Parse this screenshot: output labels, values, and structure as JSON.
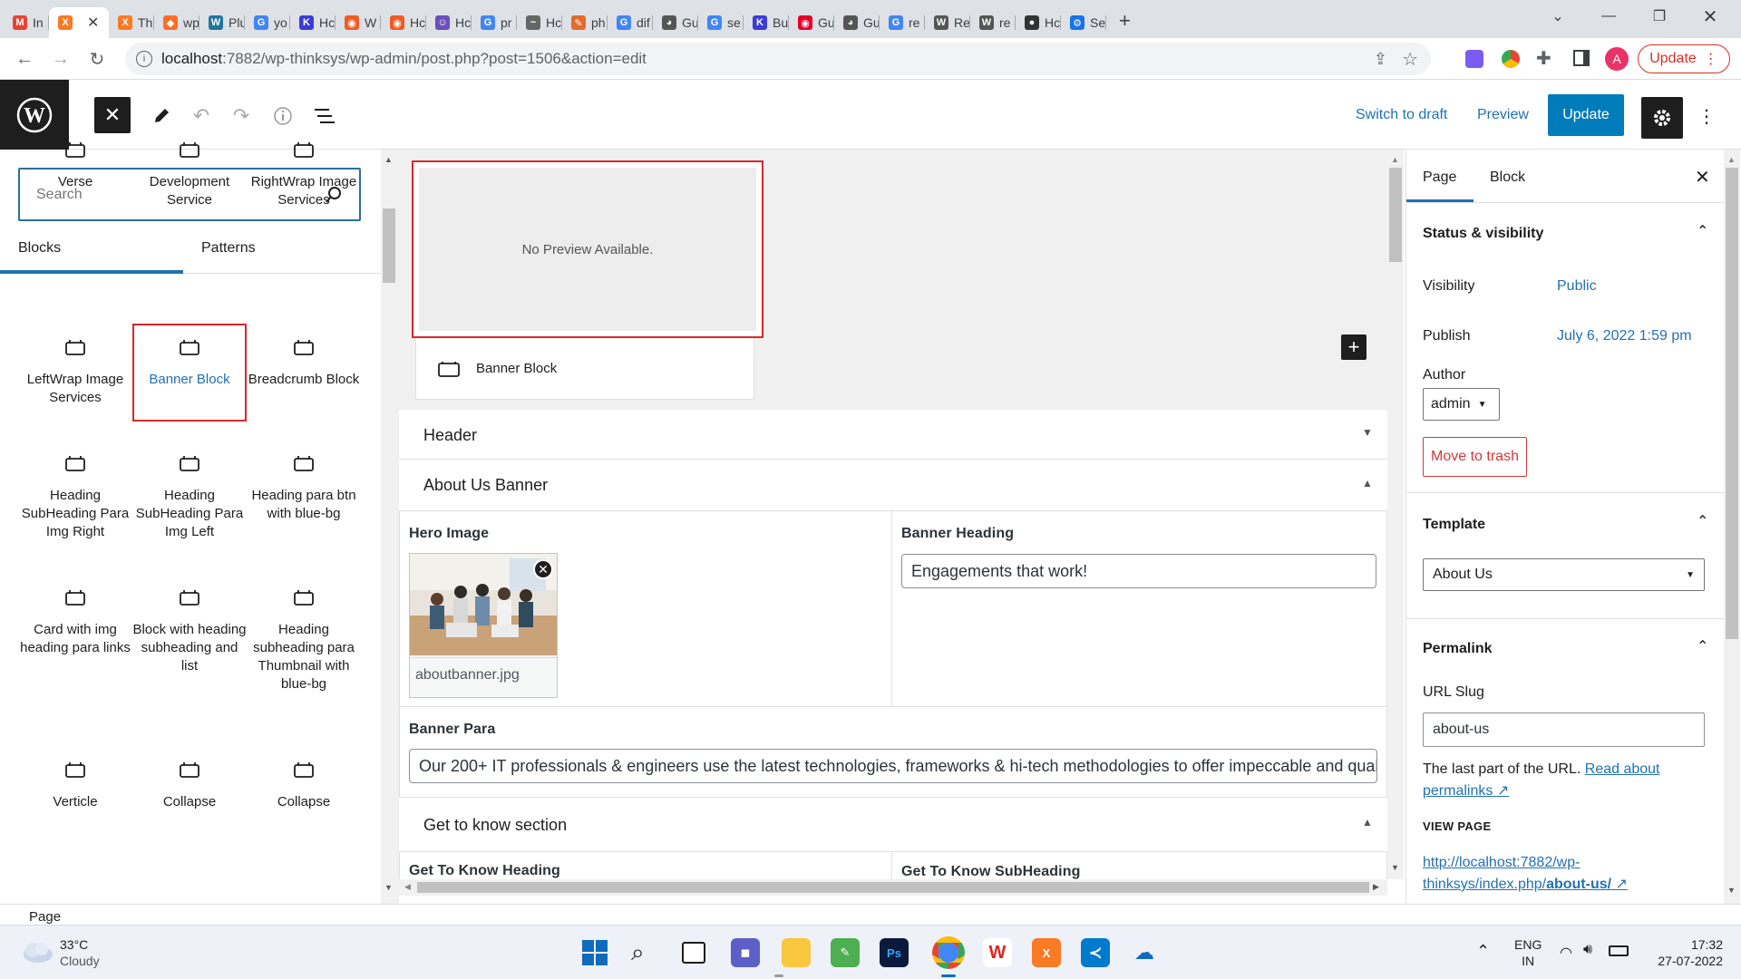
{
  "browser": {
    "tabs": [
      {
        "label": "In",
        "favicon": "gmail-icon",
        "color": "#ea4335",
        "glyph": "M"
      },
      {
        "label": "",
        "favicon": "xampp-icon",
        "color": "#fb7a24",
        "glyph": "X",
        "active": true
      },
      {
        "label": "Th",
        "favicon": "xampp-icon",
        "color": "#fb7a24",
        "glyph": "X"
      },
      {
        "label": "wp",
        "favicon": "gitlab-icon",
        "color": "#fc6d26",
        "glyph": "◆"
      },
      {
        "label": "Plu",
        "favicon": "wordpress-icon",
        "color": "#21759b",
        "glyph": "W"
      },
      {
        "label": "yo",
        "favicon": "google-icon",
        "color": "#4285f4",
        "glyph": "G"
      },
      {
        "label": "Hc",
        "favicon": "k-icon",
        "color": "#3b3bd6",
        "glyph": "K"
      },
      {
        "label": "W",
        "favicon": "ws-icon",
        "color": "#f15a24",
        "glyph": "◉"
      },
      {
        "label": "Hc",
        "favicon": "ws-icon",
        "color": "#f15a24",
        "glyph": "◉"
      },
      {
        "label": "Hc",
        "favicon": "bot-icon",
        "color": "#6b4fbb",
        "glyph": "☺"
      },
      {
        "label": "pr",
        "favicon": "google-icon",
        "color": "#4285f4",
        "glyph": "G"
      },
      {
        "label": "Hc",
        "favicon": "scribble-icon",
        "color": "#666666",
        "glyph": "~"
      },
      {
        "label": "ph",
        "favicon": "php-icon",
        "color": "#e36b2c",
        "glyph": "✎"
      },
      {
        "label": "dif",
        "favicon": "google-icon",
        "color": "#4285f4",
        "glyph": "G"
      },
      {
        "label": "Gu",
        "favicon": "globe-icon",
        "color": "#555555",
        "glyph": "◕"
      },
      {
        "label": "se",
        "favicon": "google-icon",
        "color": "#4285f4",
        "glyph": "G"
      },
      {
        "label": "Bu",
        "favicon": "k-icon",
        "color": "#3b3bd6",
        "glyph": "K"
      },
      {
        "label": "Gu",
        "favicon": "fire-icon",
        "color": "#e4002b",
        "glyph": "◉"
      },
      {
        "label": "Gu",
        "favicon": "globe-icon",
        "color": "#555555",
        "glyph": "◕"
      },
      {
        "label": "re",
        "favicon": "google-icon",
        "color": "#4285f4",
        "glyph": "G"
      },
      {
        "label": "Re",
        "favicon": "wordpress-icon",
        "color": "#555555",
        "glyph": "W"
      },
      {
        "label": "re",
        "favicon": "wordpress-icon",
        "color": "#555555",
        "glyph": "W"
      },
      {
        "label": "Hc",
        "favicon": "person-icon",
        "color": "#333333",
        "glyph": "●"
      },
      {
        "label": "Se",
        "favicon": "gear-icon",
        "color": "#1a73e8",
        "glyph": "⚙"
      }
    ],
    "url_host": "localhost",
    "url_rest": ":7882/wp-thinksys/wp-admin/post.php?post=1506&action=edit",
    "profile_initial": "A",
    "update_label": "Update"
  },
  "wp_header": {
    "switch_to_draft": "Switch to draft",
    "preview": "Preview",
    "update": "Update"
  },
  "inserter": {
    "search_placeholder": "Search",
    "tabs": [
      "Blocks",
      "Patterns"
    ],
    "rows": [
      [
        "Verse",
        "Development Service",
        "RightWrap Image Services"
      ],
      [
        "LeftWrap Image Services",
        "Banner Block",
        "Breadcrumb Block"
      ],
      [
        "Heading SubHeading Para Img Right",
        "Heading SubHeading Para Img Left",
        "Heading para btn with blue-bg"
      ],
      [
        "Card with img heading para links",
        "Block with heading subheading and list",
        "Heading subheading para Thumbnail with blue-bg"
      ],
      [
        "Verticle",
        "Collapse",
        "Collapse"
      ]
    ],
    "selected": "Banner Block"
  },
  "canvas": {
    "preview_text": "No Preview Available.",
    "block_card_title": "Banner Block",
    "sections": {
      "header": "Header",
      "about_banner": "About Us Banner",
      "get_to_know": "Get to know section"
    },
    "hero_image_label": "Hero Image",
    "hero_image_file": "aboutbanner.jpg",
    "banner_heading_label": "Banner Heading",
    "banner_heading_value": "Engagements that work!",
    "banner_para_label": "Banner Para",
    "banner_para_value": "Our 200+ IT professionals & engineers use the latest technologies, frameworks & hi-tech methodologies to offer impeccable and quality",
    "gtk_heading_label": "Get To Know Heading",
    "gtk_subheading_label": "Get To Know SubHeading"
  },
  "sidebar": {
    "tabs": [
      "Page",
      "Block"
    ],
    "status_visibility": "Status & visibility",
    "visibility_label": "Visibility",
    "visibility_value": "Public",
    "publish_label": "Publish",
    "publish_value": "July 6, 2022 1:59 pm",
    "author_label": "Author",
    "author_value": "admin",
    "move_to_trash": "Move to trash",
    "template_heading": "Template",
    "template_value": "About Us",
    "permalink_heading": "Permalink",
    "url_slug_label": "URL Slug",
    "url_slug_value": "about-us",
    "url_help_prefix": "The last part of the URL.",
    "url_help_link": "Read about permalinks",
    "view_page_label": "VIEW PAGE",
    "view_page_url_1": "http://localhost:7882/wp-",
    "view_page_url_2": "thinksys/index.php/",
    "view_page_url_3": "about-us/"
  },
  "footer": {
    "breadcrumb": "Page"
  },
  "taskbar": {
    "weather_temp": "33°C",
    "weather_desc": "Cloudy",
    "lang_1": "ENG",
    "lang_2": "IN",
    "time": "17:32",
    "date": "27-07-2022"
  }
}
